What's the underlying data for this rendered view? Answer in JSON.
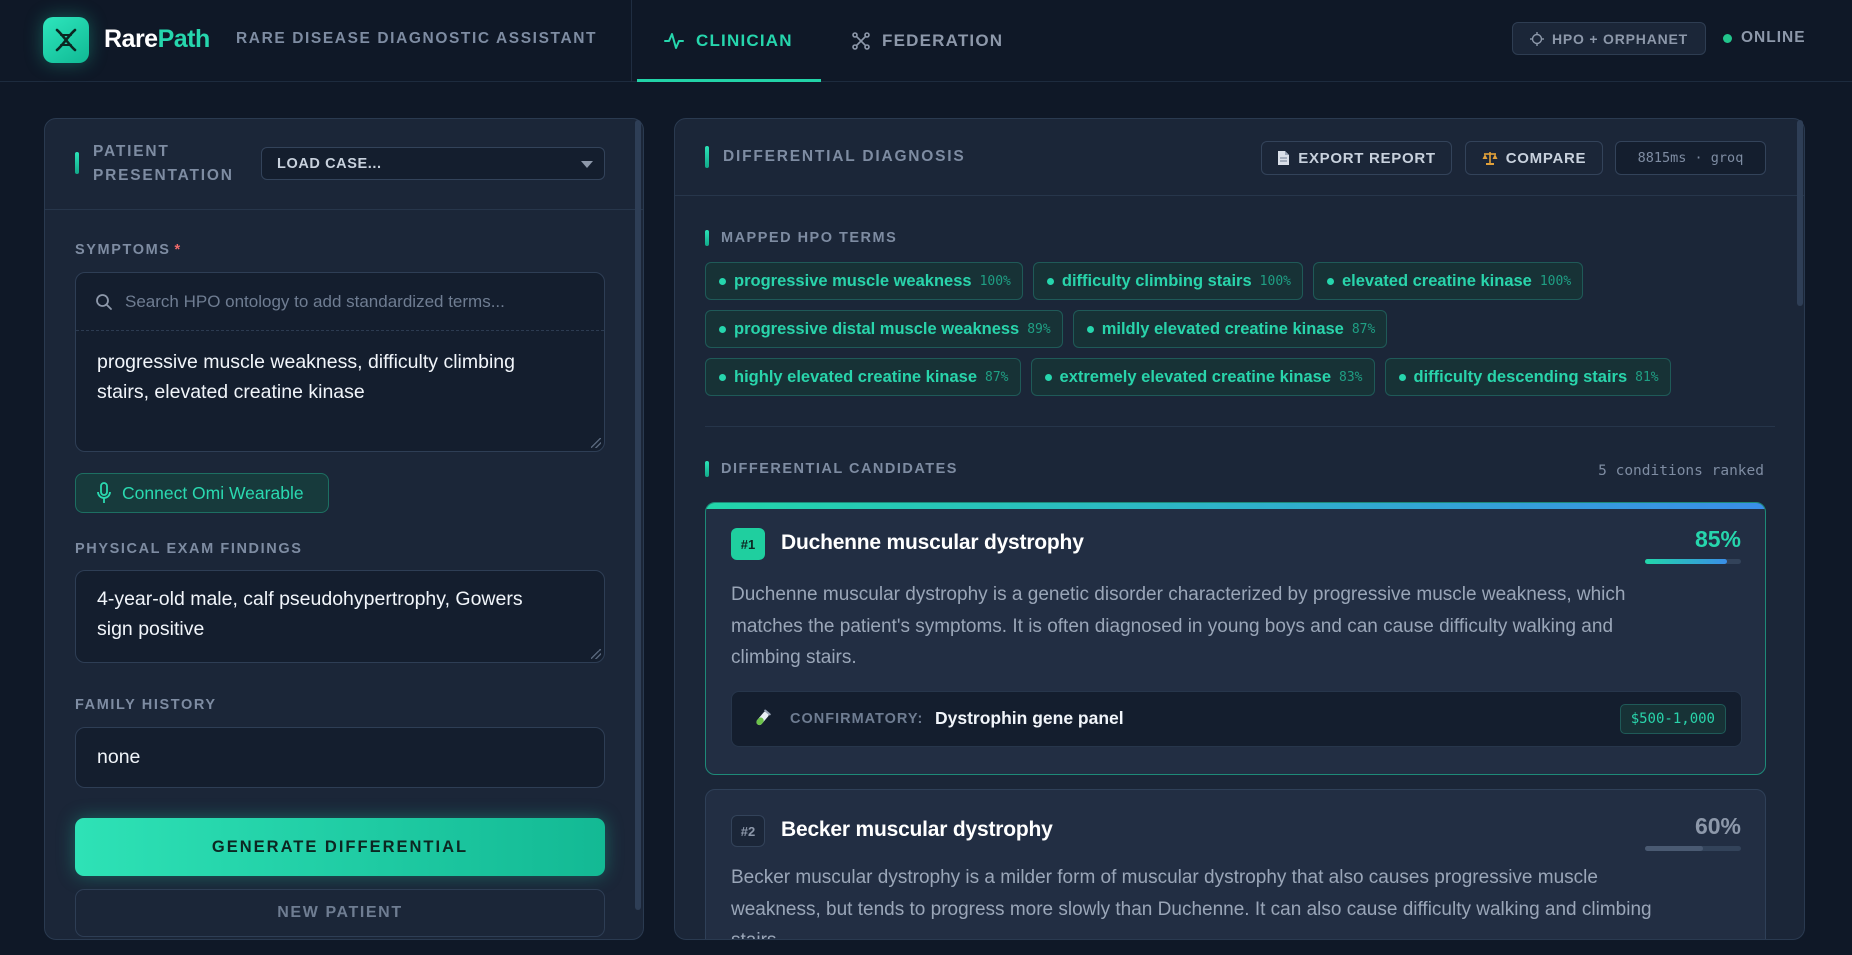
{
  "header": {
    "brand_part1": "Rare",
    "brand_part2": "Path",
    "subtitle": "RARE DISEASE DIAGNOSTIC ASSISTANT",
    "tabs": [
      {
        "label": "CLINICIAN",
        "icon": "activity-icon",
        "active": true
      },
      {
        "label": "FEDERATION",
        "icon": "network-icon",
        "active": false
      }
    ],
    "source_badge": "HPO + ORPHANET",
    "status": "ONLINE"
  },
  "left": {
    "title_line1": "PATIENT",
    "title_line2": "PRESENTATION",
    "load_case": "LOAD CASE...",
    "symptoms_label": "SYMPTOMS",
    "required_mark": "*",
    "search_placeholder": "Search HPO ontology to add standardized terms...",
    "symptoms_line1": "progressive muscle weakness, difficulty climbing",
    "symptoms_line2": "stairs, elevated creatine kinase",
    "omi_button": "Connect Omi Wearable",
    "exam_label": "PHYSICAL EXAM FINDINGS",
    "exam_line1": "4-year-old male, calf pseudohypertrophy, Gowers",
    "exam_line2": "sign positive",
    "family_label": "FAMILY HISTORY",
    "family_value": "none",
    "generate_button": "GENERATE DIFFERENTIAL",
    "new_patient_button": "NEW PATIENT"
  },
  "right": {
    "title": "DIFFERENTIAL DIAGNOSIS",
    "export_button": "EXPORT REPORT",
    "compare_button": "COMPARE",
    "timing": "8815ms · groq",
    "hpo_title": "MAPPED HPO TERMS",
    "hpo_terms": [
      [
        {
          "term": "progressive muscle weakness",
          "score": "100%"
        },
        {
          "term": "difficulty climbing stairs",
          "score": "100%"
        },
        {
          "term": "elevated creatine kinase",
          "score": "100%"
        }
      ],
      [
        {
          "term": "progressive distal muscle weakness",
          "score": "89%"
        },
        {
          "term": "mildly elevated creatine kinase",
          "score": "87%"
        }
      ],
      [
        {
          "term": "highly elevated creatine kinase",
          "score": "87%"
        },
        {
          "term": "extremely elevated creatine kinase",
          "score": "83%"
        },
        {
          "term": "difficulty descending stairs",
          "score": "81%"
        }
      ]
    ],
    "candidates_title": "DIFFERENTIAL CANDIDATES",
    "candidates_count": "5 conditions ranked",
    "candidates": [
      {
        "rank": "#1",
        "name": "Duchenne muscular dystrophy",
        "pct": "85%",
        "probability": 0.85,
        "desc_lines": [
          "Duchenne muscular dystrophy is a genetic disorder characterized by progressive muscle weakness, which",
          "matches the patient's symptoms. It is often diagnosed in young boys and can cause difficulty walking and",
          "climbing stairs."
        ],
        "confirm_label": "CONFIRMATORY:",
        "confirm_test": "Dystrophin gene panel",
        "confirm_price": "$500-1,000"
      },
      {
        "rank": "#2",
        "name": "Becker muscular dystrophy",
        "pct": "60%",
        "probability": 0.6,
        "desc_lines": [
          "Becker muscular dystrophy is a milder form of muscular dystrophy that also causes progressive muscle",
          "weakness, but tends to progress more slowly than Duchenne. It can also cause difficulty walking and climbing",
          "stairs."
        ]
      }
    ]
  },
  "colors": {
    "accent": "#26d6ad",
    "background": "#0f1827",
    "panel": "#1b2638",
    "gradient_end": "#3a8ee8"
  }
}
